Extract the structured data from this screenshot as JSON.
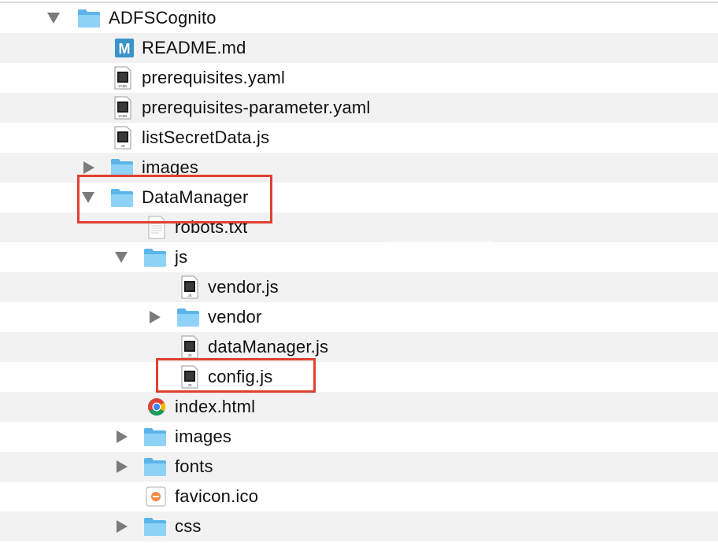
{
  "finder": {
    "rows": [
      {
        "label": "ADFSCognito",
        "icon": "folder-icon",
        "disclosure": "open"
      },
      {
        "label": "README.md",
        "icon": "markdown-file-icon",
        "badge": "M"
      },
      {
        "label": "prerequisites.yaml",
        "icon": "yaml-file-icon",
        "badge": "YAML"
      },
      {
        "label": "prerequisites-parameter.yaml",
        "icon": "yaml-file-icon",
        "badge": "YAML"
      },
      {
        "label": "listSecretData.js",
        "icon": "js-file-icon",
        "badge": "JS"
      },
      {
        "label": "images",
        "icon": "folder-icon",
        "disclosure": "closed"
      },
      {
        "label": "DataManager",
        "icon": "folder-icon",
        "disclosure": "open"
      },
      {
        "label": "robots.txt",
        "icon": "text-file-icon"
      },
      {
        "label": "js",
        "icon": "folder-icon",
        "disclosure": "open"
      },
      {
        "label": "vendor.js",
        "icon": "js-file-icon",
        "badge": "JS"
      },
      {
        "label": "vendor",
        "icon": "folder-icon",
        "disclosure": "closed"
      },
      {
        "label": "dataManager.js",
        "icon": "js-file-icon",
        "badge": "JS"
      },
      {
        "label": "config.js",
        "icon": "js-file-icon",
        "badge": "JS"
      },
      {
        "label": "index.html",
        "icon": "chrome-html-file-icon"
      },
      {
        "label": "images",
        "icon": "folder-icon",
        "disclosure": "closed"
      },
      {
        "label": "fonts",
        "icon": "folder-icon",
        "disclosure": "closed"
      },
      {
        "label": "favicon.ico",
        "icon": "ico-file-icon"
      },
      {
        "label": "css",
        "icon": "folder-icon",
        "disclosure": "closed"
      }
    ]
  },
  "colors": {
    "folder": "#6fc3f3",
    "folder_tab": "#8fd2f8",
    "highlight": "#e0412f",
    "stripe": "#f2f2f2",
    "disclosure": "#7b7b7b"
  }
}
